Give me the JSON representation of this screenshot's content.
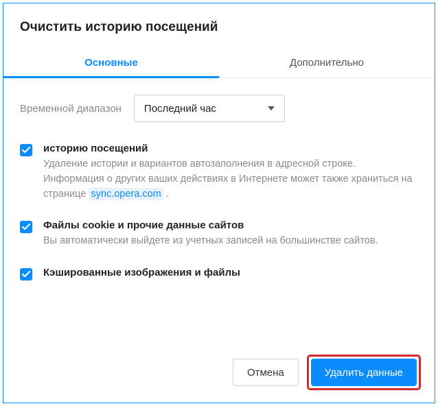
{
  "title": "Очистить историю посещений",
  "tabs": {
    "basic": "Основные",
    "advanced": "Дополнительно"
  },
  "range": {
    "label": "Временной диапазон",
    "selected": "Последний час"
  },
  "options": {
    "history": {
      "title": "историю посещений",
      "desc_before": "Удаление истории и вариантов автозаполнения в адресной строке. Информация о других ваших действиях в Интернете может также храниться на странице ",
      "link": "sync.opera.com",
      "desc_after": " ."
    },
    "cookies": {
      "title": "Файлы cookie и прочие данные сайтов",
      "desc": "Вы автоматически выйдете из учетных записей на большинстве сайтов."
    },
    "cache": {
      "title": "Кэшированные изображения и файлы"
    }
  },
  "buttons": {
    "cancel": "Отмена",
    "clear": "Удалить данные"
  }
}
